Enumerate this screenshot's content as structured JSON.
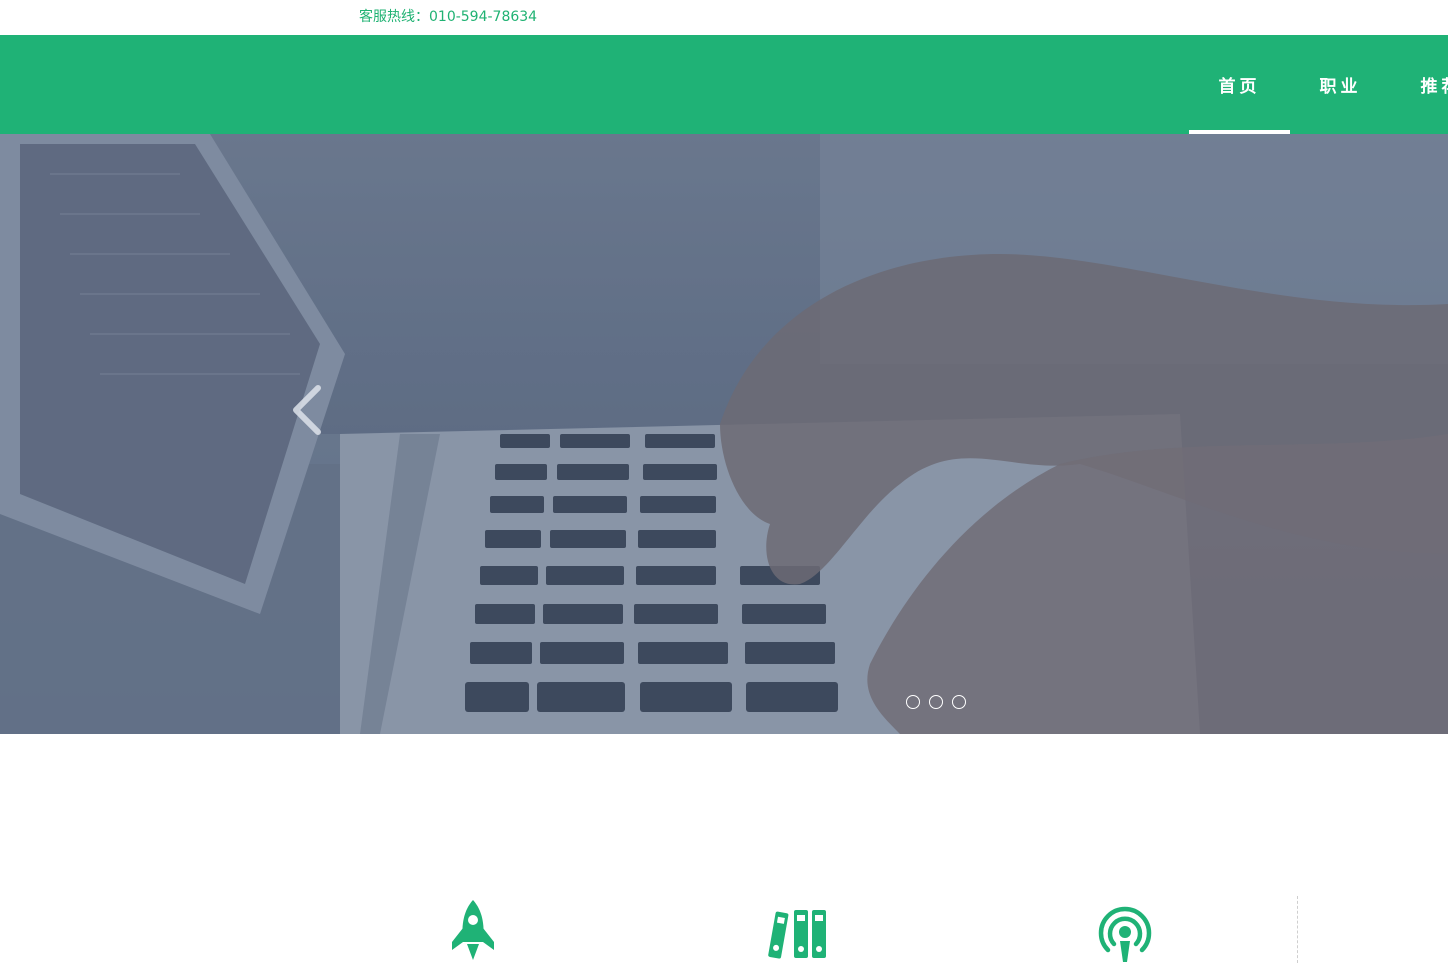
{
  "header": {
    "hotline": "客服热线：010-594-78634"
  },
  "nav": {
    "items": [
      {
        "label": "首页",
        "active": true
      },
      {
        "label": "职业",
        "active": false
      },
      {
        "label": "推荐",
        "active": false
      }
    ]
  },
  "banner": {
    "prev_icon": "chevron-left-icon",
    "slides": 3
  },
  "features": {
    "icons": [
      "rocket-icon",
      "binders-icon",
      "podcast-icon"
    ]
  },
  "colors": {
    "brand": "#1fb276",
    "hotline_text": "#20b273",
    "nav_text": "#ffffff"
  }
}
